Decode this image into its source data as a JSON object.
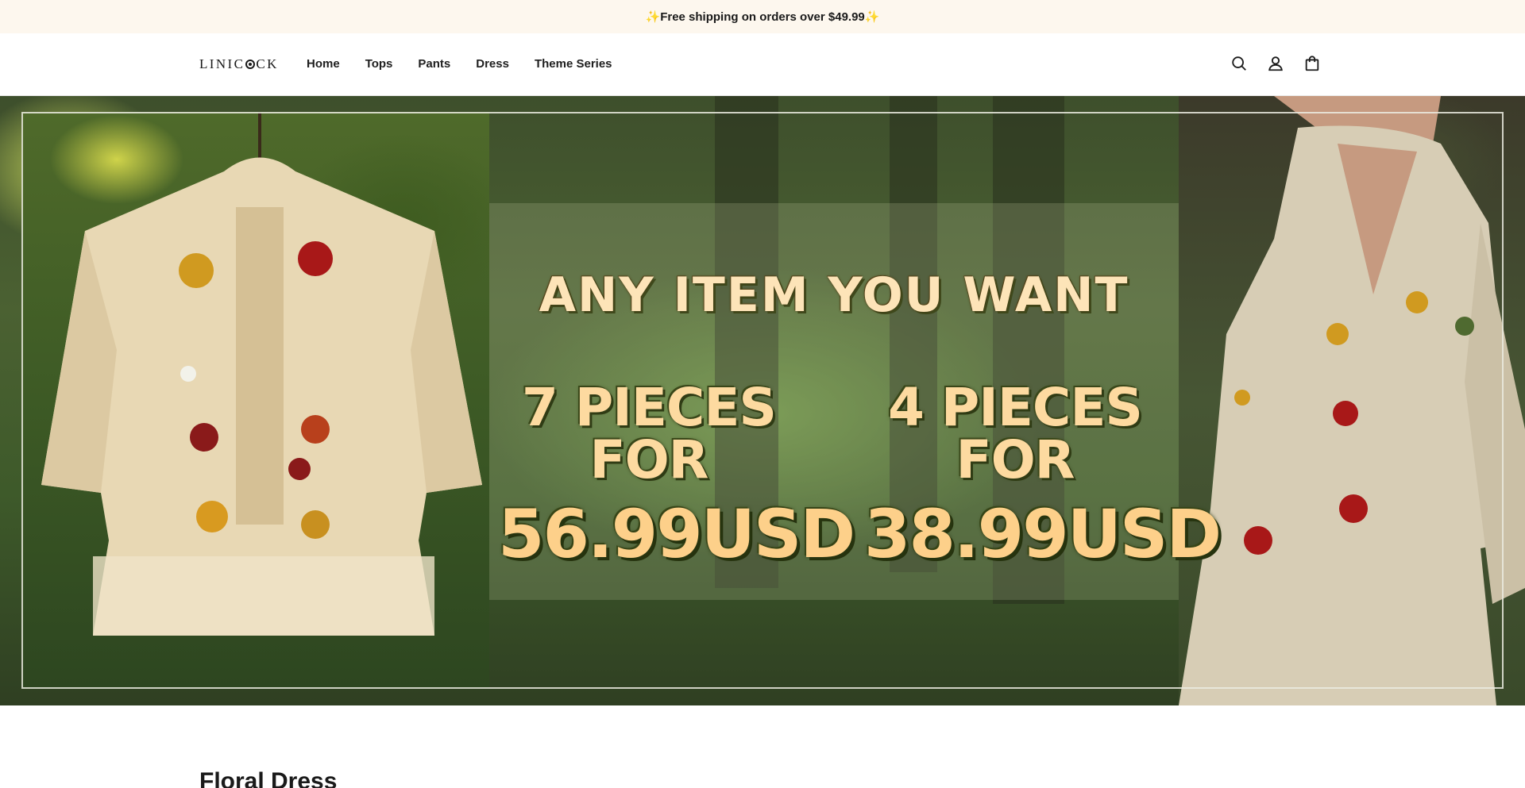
{
  "announcement": {
    "text": "✨Free shipping on orders over $49.99✨"
  },
  "header": {
    "logo_prefix": "LINIC",
    "logo_suffix": "CK",
    "nav": [
      {
        "label": "Home"
      },
      {
        "label": "Tops"
      },
      {
        "label": "Pants"
      },
      {
        "label": "Dress"
      },
      {
        "label": "Theme Series"
      }
    ],
    "icons": [
      "search-icon",
      "account-icon",
      "cart-bag-icon"
    ]
  },
  "hero": {
    "headline": "ANY ITEM YOU WANT",
    "offers": [
      {
        "pieces": "7 PIECES FOR",
        "price": "56.99USD"
      },
      {
        "pieces": "4 PIECES FOR",
        "price": "38.99USD"
      }
    ]
  },
  "section": {
    "title": "Floral Dress"
  },
  "colors": {
    "announcement_bg": "#fdf7ee",
    "headline_text": "#fde4b8",
    "price_text": "#fdd08a"
  }
}
